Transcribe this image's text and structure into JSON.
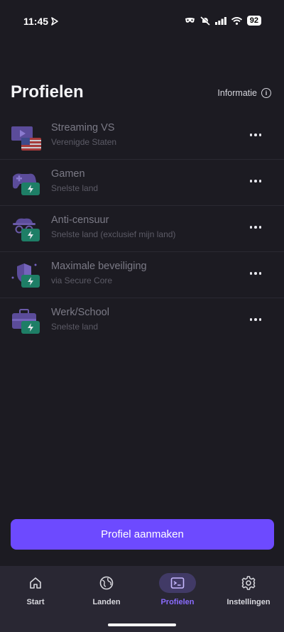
{
  "status_bar": {
    "time": "11:45",
    "battery": "92",
    "icons": [
      "location-arrow-icon",
      "mask-icon",
      "mute-icon",
      "signal-icon",
      "wifi-icon",
      "battery-icon"
    ]
  },
  "header": {
    "title": "Profielen",
    "info_label": "Informatie",
    "info_icon": "info-icon"
  },
  "profiles": [
    {
      "name": "Streaming VS",
      "subtitle": "Verenigde Staten",
      "icon": "tv-us-flag-icon"
    },
    {
      "name": "Gamen",
      "subtitle": "Snelste land",
      "icon": "gamepad-bolt-icon"
    },
    {
      "name": "Anti-censuur",
      "subtitle": "Snelste land (exclusief mijn land)",
      "icon": "spy-bolt-icon"
    },
    {
      "name": "Maximale beveiliging",
      "subtitle": "via Secure Core",
      "icon": "shield-bolt-icon"
    },
    {
      "name": "Werk/School",
      "subtitle": "Snelste land",
      "icon": "briefcase-bolt-icon"
    }
  ],
  "create_button": "Profiel aanmaken",
  "nav": {
    "tabs": [
      {
        "label": "Start",
        "icon": "home-icon"
      },
      {
        "label": "Landen",
        "icon": "globe-icon"
      },
      {
        "label": "Profielen",
        "icon": "profiles-icon",
        "active": true
      },
      {
        "label": "Instellingen",
        "icon": "gear-icon"
      }
    ]
  },
  "colors": {
    "background": "#1c1b22",
    "accent": "#6d4aff",
    "bolt_badge": "#1e7e66",
    "nav_bg": "#292733"
  }
}
